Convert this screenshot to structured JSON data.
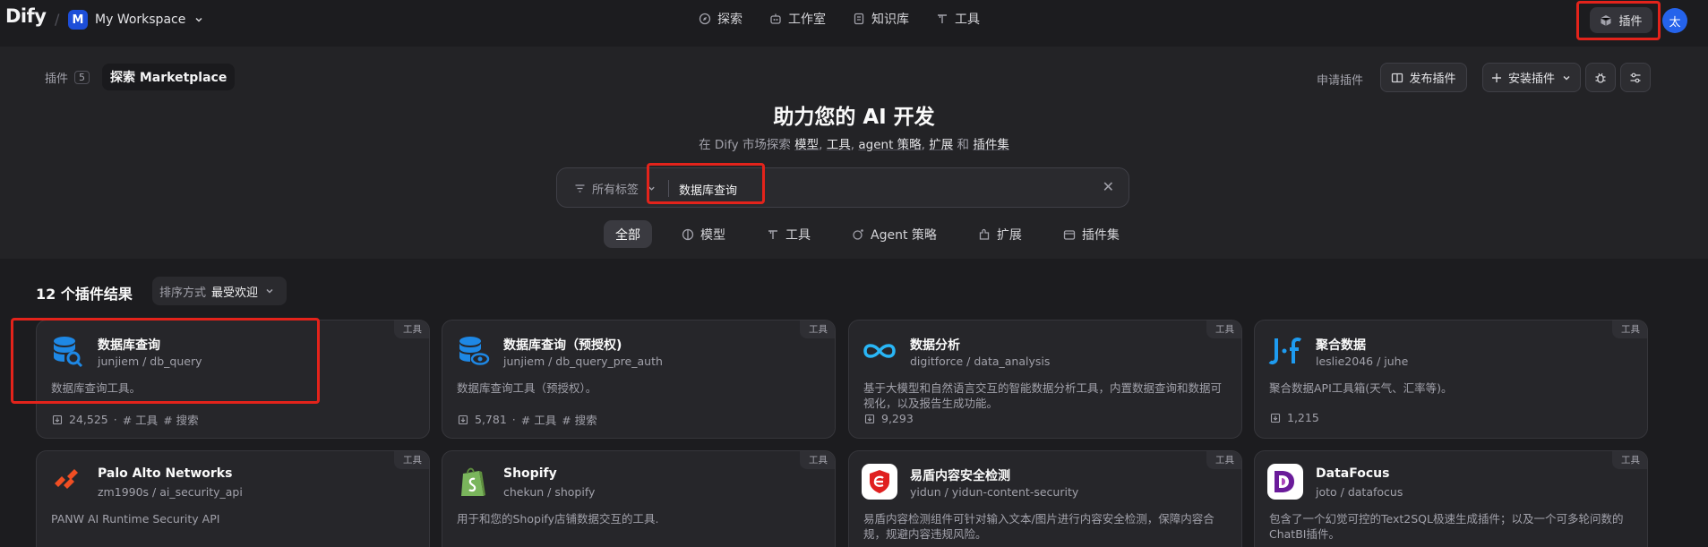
{
  "nav": {
    "logo": "Dify",
    "workspace_initial": "M",
    "workspace_name": "My Workspace",
    "items": [
      {
        "label": "探索",
        "icon": "explore-icon"
      },
      {
        "label": "工作室",
        "icon": "robot-icon"
      },
      {
        "label": "知识库",
        "icon": "book-icon"
      },
      {
        "label": "工具",
        "icon": "tools-icon"
      }
    ],
    "plugins_label": "插件",
    "avatar_initial": "太"
  },
  "header": {
    "tab_installed": "插件",
    "installed_count": "5",
    "tab_marketplace": "探索 Marketplace",
    "request_plugin": "申请插件",
    "publish_plugin": "发布插件",
    "install_plugin": "安装插件"
  },
  "hero": {
    "title": "助力您的 AI 开发",
    "sub_prefix": "在 Dify 市场探索",
    "sub_models": "模型",
    "sub_tools": "工具",
    "sub_agent": "agent 策略",
    "sub_ext": "扩展",
    "sub_and": "和",
    "sub_bundles": "插件集",
    "sep": ","
  },
  "search": {
    "tag_filter": "所有标签",
    "value": "数据库查询"
  },
  "categories": [
    {
      "label": "全部",
      "icon": "",
      "active": true
    },
    {
      "label": "模型",
      "icon": "model-icon"
    },
    {
      "label": "工具",
      "icon": "tool-icon"
    },
    {
      "label": "Agent 策略",
      "icon": "agent-icon"
    },
    {
      "label": "扩展",
      "icon": "extension-icon"
    },
    {
      "label": "插件集",
      "icon": "bundle-icon"
    }
  ],
  "results": {
    "count_label": "12 个插件结果",
    "sort_prefix": "排序方式",
    "sort_value": "最受欢迎"
  },
  "plugins": [
    {
      "name": "数据库查询",
      "slug": "junjiem / db_query",
      "desc": "数据库查询工具。",
      "installs": "24,525",
      "tags": [
        "# 工具",
        "# 搜索"
      ],
      "type": "工具",
      "icon": "database-search-icon"
    },
    {
      "name": "数据库查询（预授权)",
      "slug": "junjiem / db_query_pre_auth",
      "desc": "数据库查询工具（预授权）。",
      "installs": "5,781",
      "tags": [
        "# 工具",
        "# 搜索"
      ],
      "type": "工具",
      "icon": "database-eye-icon"
    },
    {
      "name": "数据分析",
      "slug": "digitforce / data_analysis",
      "desc": "基于大模型和自然语言交互的智能数据分析工具，内置数据查询和数据可视化，以及报告生成功能。",
      "installs": "9,293",
      "tags": [],
      "type": "工具",
      "icon": "infinity-icon"
    },
    {
      "name": "聚合数据",
      "slug": "leslie2046 / juhe",
      "desc": "聚合数据API工具箱(天气、汇率等)。",
      "installs": "1,215",
      "tags": [],
      "type": "工具",
      "icon": "juhe-logo-icon"
    },
    {
      "name": "Palo Alto Networks",
      "slug": "zm1990s / ai_security_api",
      "desc": "PANW AI Runtime Security API",
      "type": "工具",
      "icon": "paloalto-logo-icon"
    },
    {
      "name": "Shopify",
      "slug": "chekun / shopify",
      "desc": "用于和您的Shopify店铺数据交互的工具.",
      "type": "工具",
      "icon": "shopify-logo-icon"
    },
    {
      "name": "易盾内容安全检测",
      "slug": "yidun / yidun-content-security",
      "desc": "易盾内容检测组件可针对输入文本/图片进行内容安全检测，保障内容合规，规避内容违规风险。",
      "type": "工具",
      "icon": "yidun-logo-icon"
    },
    {
      "name": "DataFocus",
      "slug": "joto / datafocus",
      "desc": "包含了一个幻觉可控的Text2SQL极速生成插件；以及一个可多轮问数的ChatBI插件。",
      "type": "工具",
      "icon": "datafocus-logo-icon"
    }
  ],
  "colors": {
    "accent_blue": "#2563eb",
    "highlight_red": "#e3231b",
    "background": "#1c1c1f"
  }
}
